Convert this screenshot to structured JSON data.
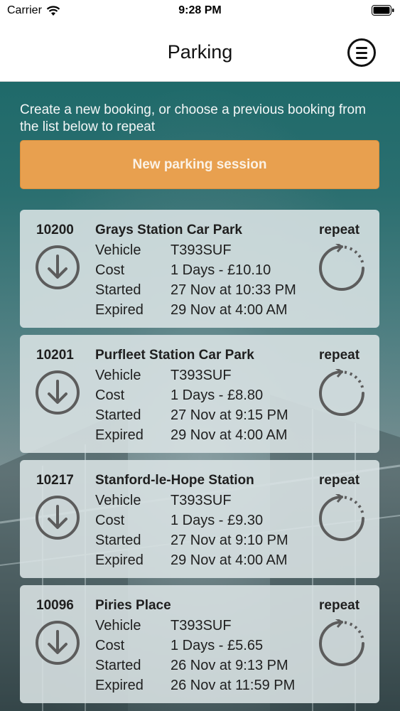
{
  "status_bar": {
    "carrier": "Carrier",
    "time": "9:28 PM"
  },
  "header": {
    "title": "Parking"
  },
  "intro_text": "Create a new booking, or choose a previous booking from the list below to repeat",
  "new_session_label": "New parking session",
  "labels": {
    "vehicle": "Vehicle",
    "cost": "Cost",
    "started": "Started",
    "expired": "Expired",
    "repeat": "repeat"
  },
  "bookings": [
    {
      "id": "10200",
      "car_park": "Grays Station Car Park",
      "vehicle": "T393SUF",
      "cost": "1 Days - £10.10",
      "started": "27 Nov at 10:33 PM",
      "expired": "29 Nov at 4:00 AM"
    },
    {
      "id": "10201",
      "car_park": "Purfleet Station Car Park",
      "vehicle": "T393SUF",
      "cost": "1 Days - £8.80",
      "started": "27 Nov at 9:15 PM",
      "expired": "29 Nov at 4:00 AM"
    },
    {
      "id": "10217",
      "car_park": "Stanford-le-Hope Station",
      "vehicle": "T393SUF",
      "cost": "1 Days - £9.30",
      "started": "27 Nov at 9:10 PM",
      "expired": "29 Nov at 4:00 AM"
    },
    {
      "id": "10096",
      "car_park": "Piries Place",
      "vehicle": "T393SUF",
      "cost": "1 Days - £5.65",
      "started": "26 Nov at 9:13 PM",
      "expired": "26 Nov at 11:59 PM"
    }
  ],
  "icons": {
    "menu": "menu-icon",
    "download": "download-circle-icon",
    "repeat": "repeat-icon",
    "wifi": "wifi-icon",
    "battery": "battery-icon"
  },
  "colors": {
    "accent": "#e8a04f",
    "header_bg": "#ffffff",
    "card_bg": "#dbe4e5",
    "teal": "#1f6a6a"
  }
}
